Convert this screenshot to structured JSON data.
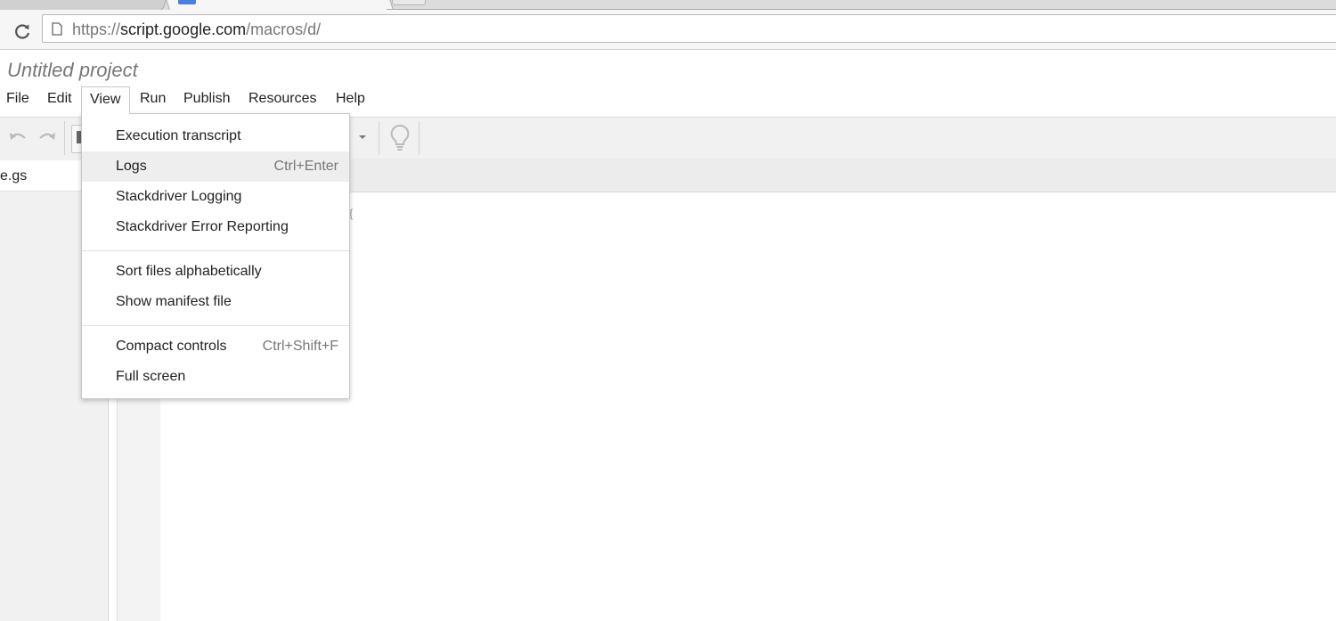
{
  "browser": {
    "url_scheme": "https://",
    "url_host": "script.google.com",
    "url_path": "/macros/d/"
  },
  "app": {
    "project_title": "Untitled project",
    "menu": [
      "File",
      "Edit",
      "View",
      "Run",
      "Publish",
      "Resources",
      "Help"
    ],
    "open_menu": "View",
    "file_name": "e.gs",
    "code_hint": "{"
  },
  "view_menu": {
    "groups": [
      [
        {
          "label": "Execution transcript",
          "shortcut": ""
        },
        {
          "label": "Logs",
          "shortcut": "Ctrl+Enter",
          "highlighted": true
        },
        {
          "label": "Stackdriver Logging",
          "shortcut": ""
        },
        {
          "label": "Stackdriver Error Reporting",
          "shortcut": ""
        }
      ],
      [
        {
          "label": "Sort files alphabetically",
          "shortcut": ""
        },
        {
          "label": "Show manifest file",
          "shortcut": ""
        }
      ],
      [
        {
          "label": "Compact controls",
          "shortcut": "Ctrl+Shift+F"
        },
        {
          "label": "Full screen",
          "shortcut": ""
        }
      ]
    ]
  },
  "icons": {
    "reload": "reload-icon",
    "page": "page-icon",
    "undo": "undo-icon",
    "redo": "redo-icon",
    "dropdown": "caret-down-icon",
    "lightbulb": "lightbulb-icon"
  }
}
